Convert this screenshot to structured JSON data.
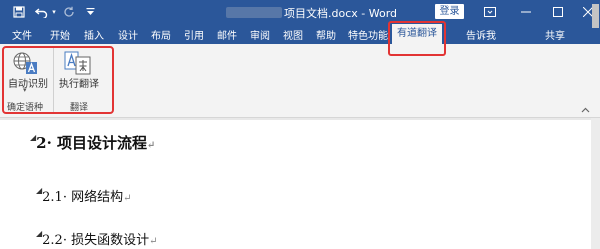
{
  "window": {
    "title_suffix": "项目文档.docx - Word",
    "login_label": "登录"
  },
  "tabs": [
    {
      "label": "文件"
    },
    {
      "label": "开始"
    },
    {
      "label": "插入"
    },
    {
      "label": "设计"
    },
    {
      "label": "布局"
    },
    {
      "label": "引用"
    },
    {
      "label": "邮件"
    },
    {
      "label": "审阅"
    },
    {
      "label": "视图"
    },
    {
      "label": "帮助"
    },
    {
      "label": "特色功能"
    },
    {
      "label": "有道翻译",
      "active": true
    }
  ],
  "tell_me": "告诉我",
  "share": "共享",
  "ribbon": {
    "auto_detect_label": "自动识别",
    "execute_label": "执行翻译",
    "group_language": "确定语种",
    "group_translate": "翻译"
  },
  "document": {
    "heading1": "2· 项目设计流程",
    "heading2_1": "2.1· 网络结构",
    "heading2_2": "2.2· 损失函数设计",
    "para_mark": "↵"
  },
  "colors": {
    "title_bar": "#2b579a",
    "highlight": "#e23434"
  }
}
